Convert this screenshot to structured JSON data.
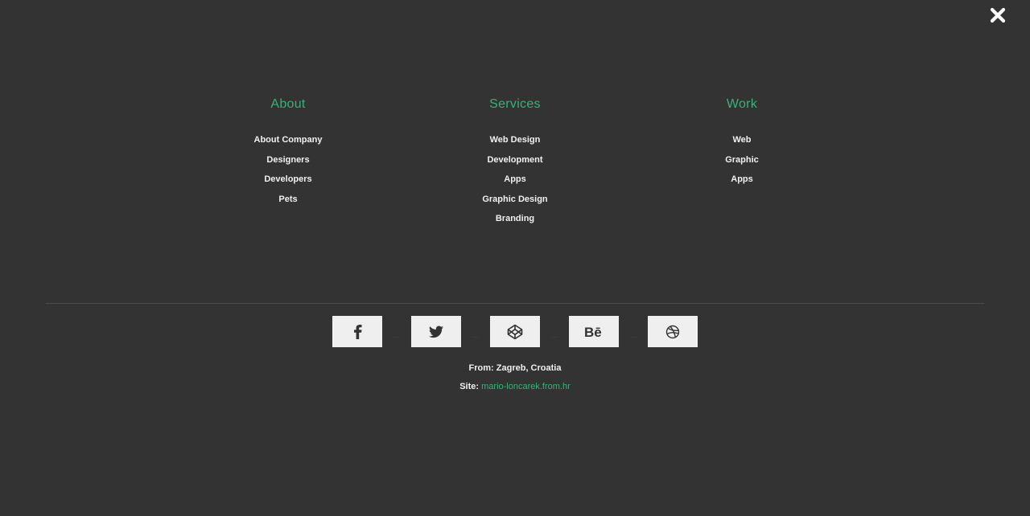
{
  "close_icon": "close-icon",
  "columns": [
    {
      "title": "About",
      "items": [
        "About Company",
        "Designers",
        "Developers",
        "Pets"
      ]
    },
    {
      "title": "Services",
      "items": [
        "Web Design",
        "Development",
        "Apps",
        "Graphic Design",
        "Branding"
      ]
    },
    {
      "title": "Work",
      "items": [
        "Web",
        "Graphic",
        "Apps"
      ]
    }
  ],
  "social": [
    "facebook-icon",
    "twitter-icon",
    "codepen-icon",
    "behance-icon",
    "dribbble-icon"
  ],
  "info": {
    "from_label": "From: Zagreb, Croatia",
    "site_label": "Site:",
    "site_link": "mario-loncarek.from.hr"
  },
  "colors": {
    "background": "#333333",
    "accent": "#3ab07a",
    "text": "#f0f0f0",
    "button": "#efefef"
  }
}
